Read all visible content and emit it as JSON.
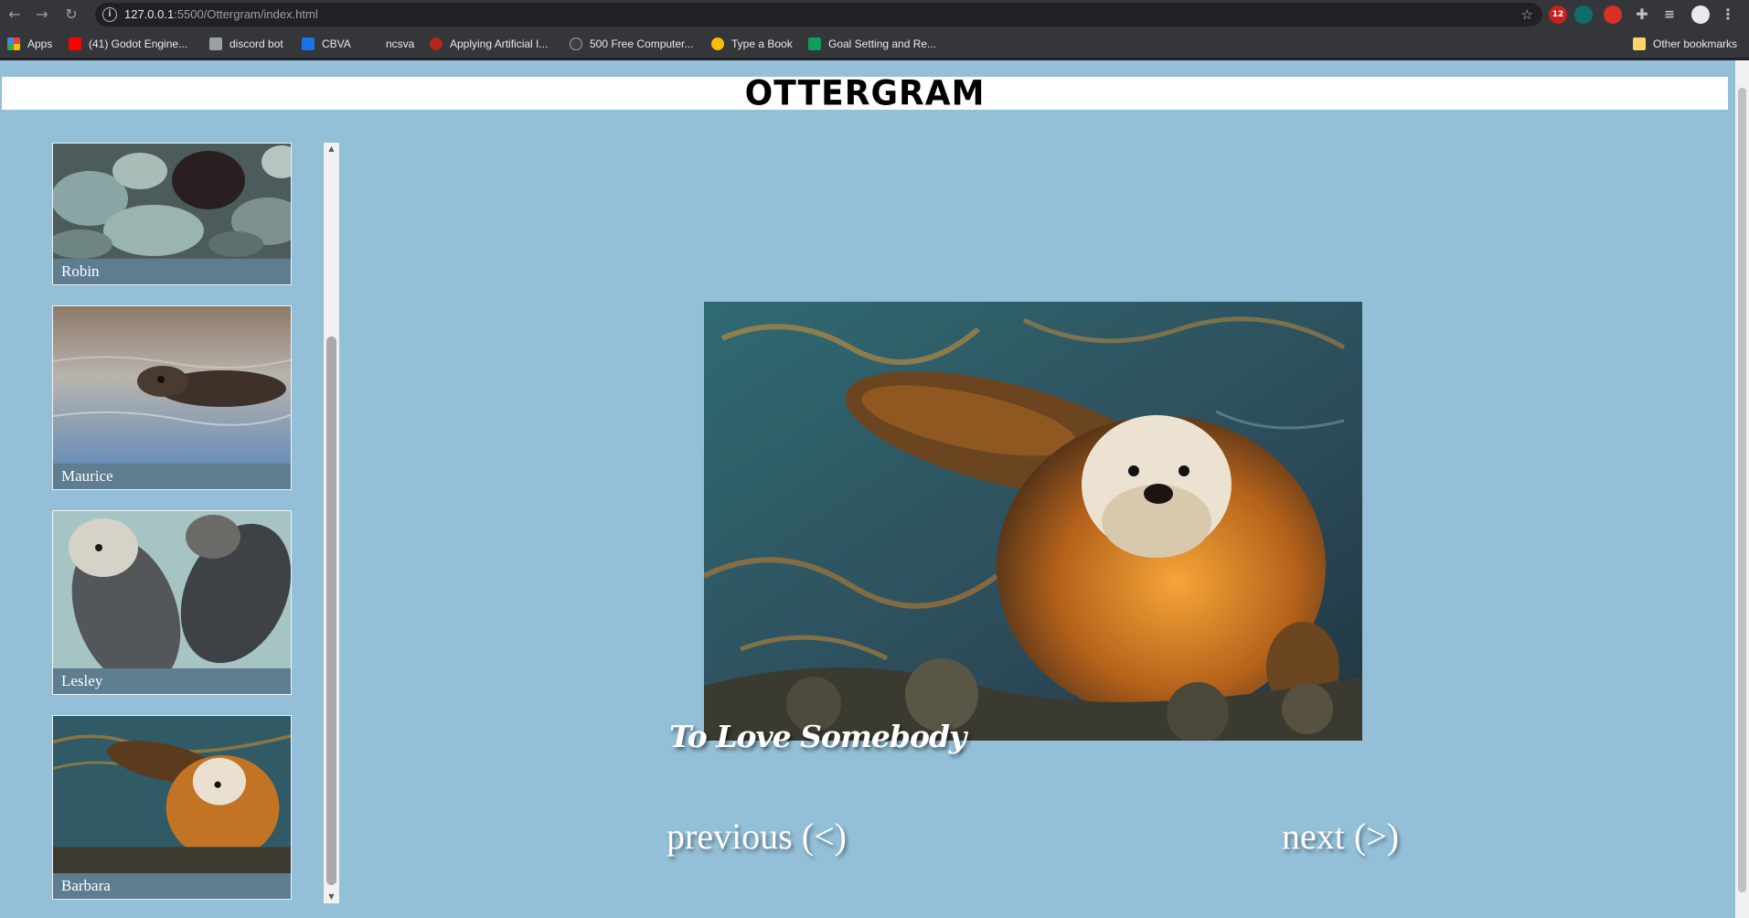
{
  "browser": {
    "url_host": "127.0.0.1",
    "url_path": ":5500/Ottergram/index.html",
    "bookmarks": [
      {
        "label": "Apps",
        "color": "#ea4335"
      },
      {
        "label": "(41) Godot Engine...",
        "color": "#ff0000"
      },
      {
        "label": "discord bot",
        "color": "#9aa0a6"
      },
      {
        "label": "CBVA",
        "color": "#1a73e8"
      },
      {
        "label": "ncsva",
        "color": "#35363a"
      },
      {
        "label": "Applying Artificial I...",
        "color": "#b3261e"
      },
      {
        "label": "500 Free Computer...",
        "color": "#3c4043"
      },
      {
        "label": "Type a Book",
        "color": "#fbbc04"
      },
      {
        "label": "Goal Setting and Re...",
        "color": "#0f9d58"
      }
    ],
    "other_bookmarks": "Other bookmarks",
    "ext_badge": "12"
  },
  "page": {
    "logo": "OTTERGRAM",
    "background": "#93c0d8"
  },
  "thumbnails": [
    {
      "name": "Robin"
    },
    {
      "name": "Maurice"
    },
    {
      "name": "Lesley"
    },
    {
      "name": "Barbara"
    }
  ],
  "detail": {
    "title": "To Love Somebody"
  },
  "navigation": {
    "previous": "previous (<)",
    "next": "next (>)"
  }
}
